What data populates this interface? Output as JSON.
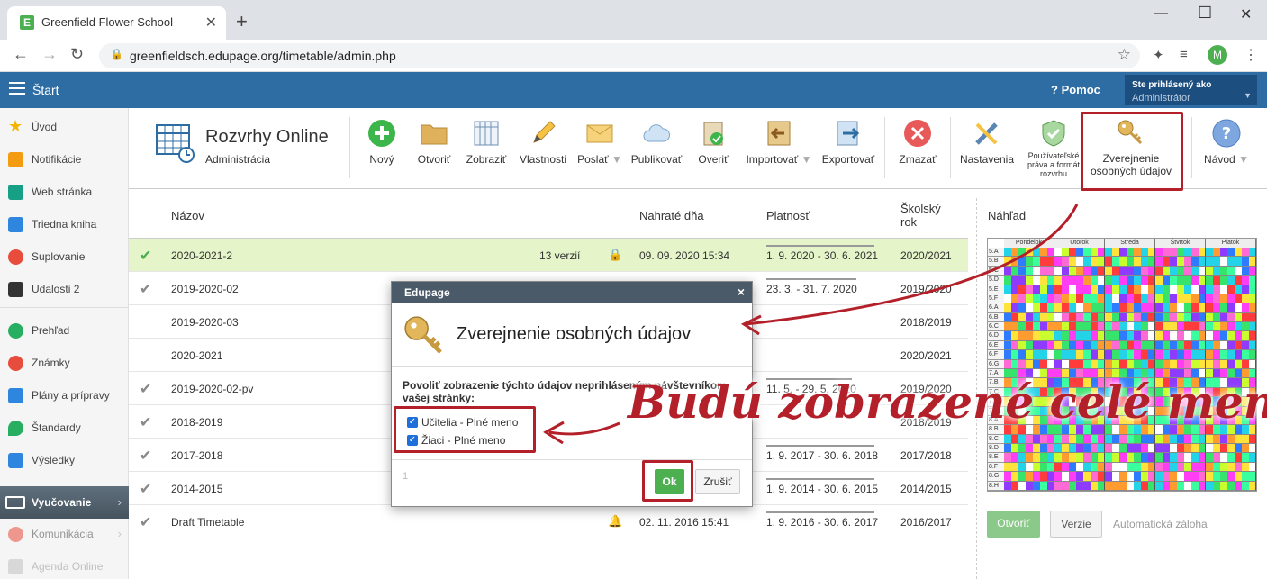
{
  "browser": {
    "tab_title": "Greenfield Flower School",
    "tab_favicon": "E",
    "url": "greenfieldsch.edupage.org/timetable/admin.php",
    "profile_initial": "M"
  },
  "appbar": {
    "start": "Štart",
    "help": "Pomoc",
    "logged_in_label": "Ste prihlásený ako",
    "user_role": "Administrátor"
  },
  "sidebar": {
    "items": [
      {
        "label": "Úvod",
        "color": "#f4b400"
      },
      {
        "label": "Notifikácie",
        "color": "#f39c12"
      },
      {
        "label": "Web stránka",
        "color": "#16a085"
      },
      {
        "label": "Triedna kniha",
        "color": "#2e86de"
      },
      {
        "label": "Suplovanie",
        "color": "#e74c3c"
      },
      {
        "label": "Udalosti 2",
        "color": "#333333"
      },
      {
        "label": "Prehľad",
        "color": "#27ae60"
      },
      {
        "label": "Známky",
        "color": "#e74c3c"
      },
      {
        "label": "Plány a prípravy",
        "color": "#2e86de"
      },
      {
        "label": "Štandardy",
        "color": "#27ae60"
      },
      {
        "label": "Výsledky",
        "color": "#2e86de"
      },
      {
        "label": "Vyučovanie",
        "color": "#ffffff"
      },
      {
        "label": "Komunikácia",
        "color": "#e74c3c"
      },
      {
        "label": "Agenda Online",
        "color": "#999999"
      }
    ]
  },
  "toolbar": {
    "app_title": "Rozvrhy Online",
    "app_subtitle": "Administrácia",
    "buttons": {
      "new": "Nový",
      "open": "Otvoriť",
      "show": "Zobraziť",
      "properties": "Vlastnosti",
      "send": "Poslať",
      "publish": "Publikovať",
      "verify": "Overiť",
      "import": "Importovať",
      "export": "Exportovať",
      "delete": "Zmazať",
      "settings": "Nastavenia",
      "user_rights_l1": "Používateľské",
      "user_rights_l2": "práva a formát",
      "user_rights_l3": "rozvrhu",
      "publish_personal_l1": "Zverejnenie",
      "publish_personal_l2": "osobných údajov",
      "guide": "Návod"
    }
  },
  "table": {
    "headers": {
      "name": "Názov",
      "uploaded": "Nahraté dňa",
      "validity": "Platnosť",
      "school_year_l1": "Školský",
      "school_year_l2": "rok"
    },
    "rows": [
      {
        "name": "2020-2021-2",
        "versions": "13 verzií",
        "uploaded": "09. 09. 2020 15:34",
        "validity": "1. 9. 2020 - 30. 6. 2021",
        "year": "2020/2021"
      },
      {
        "name": "2019-2020-02",
        "versions": "",
        "uploaded": "",
        "validity": "23. 3. - 31. 7. 2020",
        "year": "2019/2020"
      },
      {
        "name": "2019-2020-03",
        "versions": "",
        "uploaded": "",
        "validity": "",
        "year": "2018/2019"
      },
      {
        "name": "2020-2021",
        "versions": "",
        "uploaded": "",
        "validity": "",
        "year": "2020/2021"
      },
      {
        "name": "2019-2020-02-pv",
        "versions": "",
        "uploaded": "",
        "validity": "11. 5. - 29. 5. 2020",
        "year": "2019/2020"
      },
      {
        "name": "2018-2019",
        "versions": "",
        "uploaded": "",
        "validity": "",
        "year": "2018/2019"
      },
      {
        "name": "2017-2018",
        "versions": "",
        "uploaded": "",
        "validity": "1. 9. 2017 - 30. 6. 2018",
        "year": "2017/2018"
      },
      {
        "name": "2014-2015",
        "versions": "",
        "uploaded": "",
        "validity": "1. 9. 2014 - 30. 6. 2015",
        "year": "2014/2015"
      },
      {
        "name": "Draft Timetable",
        "versions": "",
        "uploaded": "02. 11. 2016 15:41",
        "validity": "1. 9. 2016 - 30. 6. 2017",
        "year": "2016/2017"
      }
    ]
  },
  "preview": {
    "label": "Náhľad",
    "days": [
      "Pondelok",
      "Utorok",
      "Streda",
      "Štvrtok",
      "Piatok"
    ],
    "classes": [
      "5.A",
      "5.B",
      "5.C",
      "5.D",
      "5.E",
      "5.F",
      "6.A",
      "6.B",
      "6.C",
      "6.D",
      "6.E",
      "6.F",
      "6.G",
      "7.A",
      "7.B",
      "7.C",
      "7.D",
      "7.E",
      "8.A",
      "8.B",
      "8.C",
      "8.D",
      "8.E",
      "8.F",
      "8.G",
      "8.H"
    ],
    "open": "Otvoriť",
    "versions": "Verzie",
    "autosave": "Automatická záloha"
  },
  "dialog": {
    "header": "Edupage",
    "close": "×",
    "title": "Zverejnenie osobných údajov",
    "description": "Povoliť zobrazenie týchto údajov neprihláseným návštevníkom vašej stránky:",
    "options": [
      {
        "label": "Učitelia - Plné meno",
        "checked": true
      },
      {
        "label": "Žiaci - Plné meno",
        "checked": true
      }
    ],
    "page": "1",
    "ok": "Ok",
    "cancel": "Zrušiť"
  },
  "annotation": {
    "text": "Budú zobrazené celé mená",
    "color": "#b3202a"
  }
}
